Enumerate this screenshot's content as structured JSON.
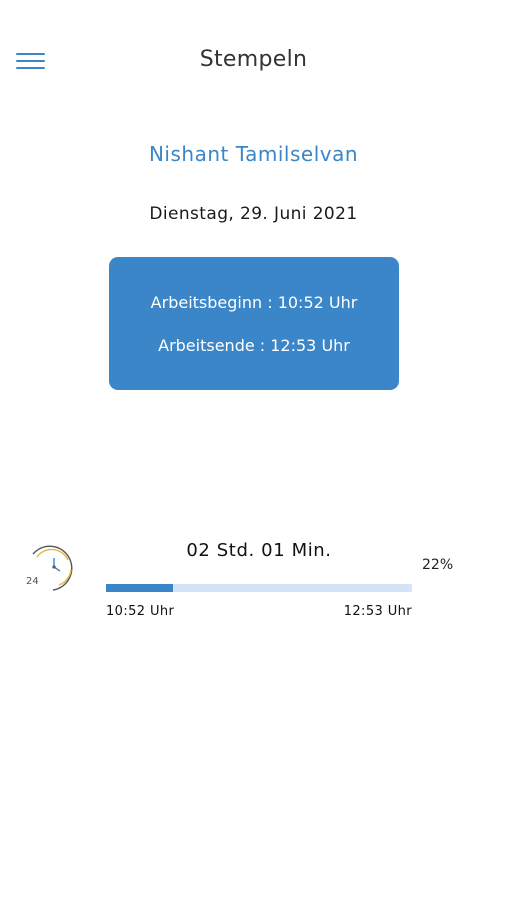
{
  "header": {
    "title": "Stempeln",
    "menu_icon": "hamburger-menu-icon"
  },
  "user": {
    "name": "Nishant Tamilselvan"
  },
  "date": "Dienstag, 29. Juni 2021",
  "work_card": {
    "start": "Arbeitsbeginn : 10:52 Uhr",
    "end": "Arbeitsende : 12:53 Uhr",
    "background_color": "#3b86c9"
  },
  "tracker": {
    "icon": "clock-24h-icon",
    "icon_text": "24",
    "duration": "02 Std. 01 Min.",
    "percent_label": "22%",
    "progress_fraction": 0.22,
    "start_time": "10:52 Uhr",
    "end_time": "12:53 Uhr"
  },
  "colors": {
    "accent": "#3b86c9",
    "track": "#d5e3f7"
  }
}
